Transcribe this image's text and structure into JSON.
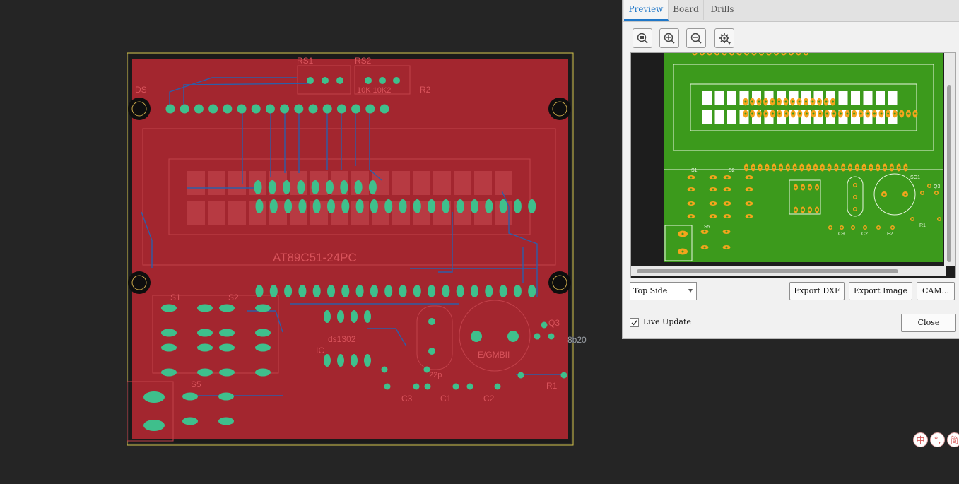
{
  "panel": {
    "tabs": [
      "Preview",
      "Board",
      "Drills"
    ],
    "active_tab": "Preview",
    "toolbar_icons": [
      "fit-view-icon",
      "zoom-in-icon",
      "zoom-out-icon",
      "settings-gear-icon"
    ],
    "side_select": "Top Side",
    "buttons": {
      "export_dxf": "Export DXF",
      "export_image": "Export Image",
      "cam": "CAM..."
    },
    "live_update": {
      "label": "Live Update",
      "checked": true
    },
    "close": "Close"
  },
  "board_labels": {
    "rs1": "RS1",
    "rs2": "RS2",
    "ds": "DS",
    "r2": "R2",
    "resistor_values": "10K  10K2",
    "chip": "AT89C51-24PC",
    "s1": "S1",
    "s2": "S2",
    "s5": "S5",
    "ds1302": "ds1302",
    "ic": "IC",
    "buzzer": "E/GMBII",
    "c3": "C3",
    "c1": "C1",
    "c2": "C2",
    "r1": "R1",
    "q3": "Q3",
    "q_part": "8b20",
    "cap_val": "22p"
  },
  "preview_labels": {
    "s1": "S1",
    "s2": "S2",
    "s5": "S5",
    "sg1": "SG1",
    "c9": "C9",
    "c2": "C2",
    "e2": "E2",
    "r1": "R1",
    "q3": "Q3"
  },
  "ime": [
    "中",
    "°,",
    "简"
  ],
  "colors": {
    "board": "#a3262f",
    "pad": "#3fbf8c",
    "trace": "#2d5ea8",
    "preview_green": "#3c9a1c",
    "preview_pad": "#f4a51c",
    "accent": "#1f77c8"
  }
}
